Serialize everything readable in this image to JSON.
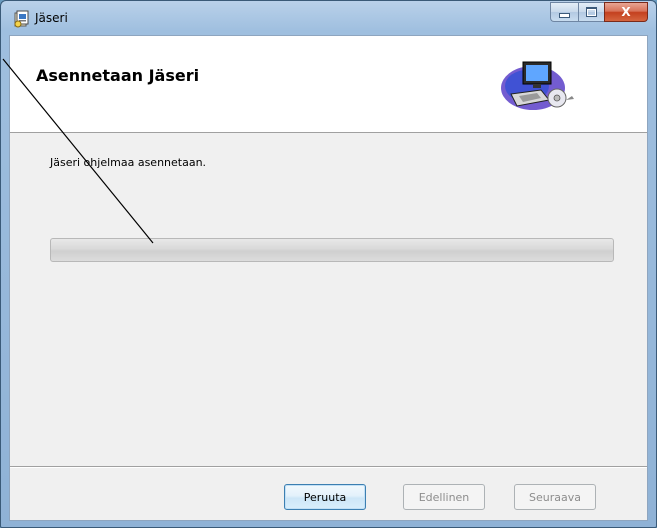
{
  "window": {
    "title": "Jäseri",
    "app_icon": "installer-package-icon",
    "caption_buttons": {
      "minimize": "minimize-icon",
      "maximize": "maximize-icon",
      "close_label": "X"
    }
  },
  "header": {
    "title": "Asennetaan Jäseri",
    "banner_icon": "computer-setup-icon"
  },
  "body": {
    "status_text": "Jäseri ohjelmaa asennetaan.",
    "progress_fraction": 0.0
  },
  "footer": {
    "cancel_label": "Peruuta",
    "back_label": "Edellinen",
    "next_label": "Seuraava"
  },
  "colors": {
    "accent_button_border": "#3c7fb1",
    "close_button": "#c4401f",
    "progress_fill": "#48b218"
  }
}
